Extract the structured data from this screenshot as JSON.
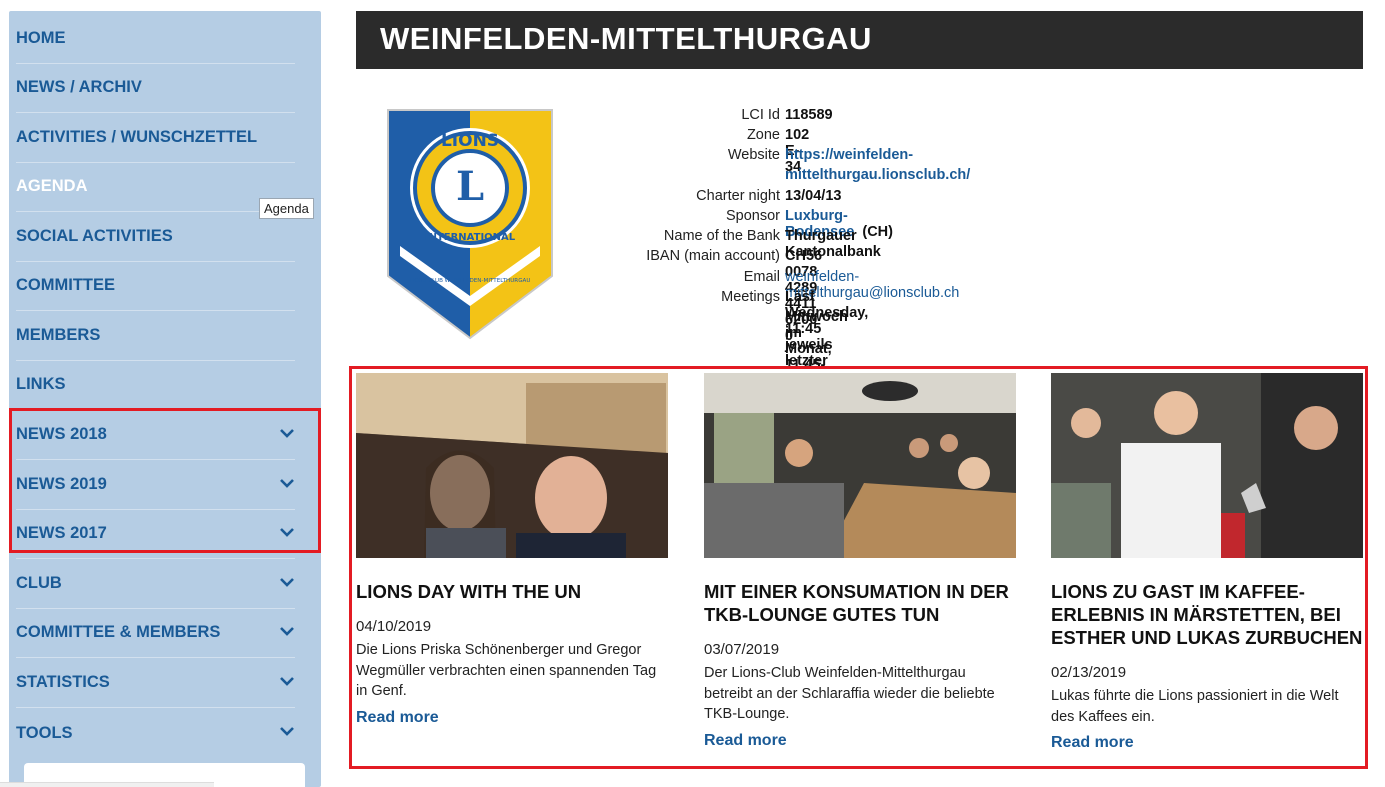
{
  "sidebar": {
    "items": [
      {
        "label": "HOME",
        "has_chevron": false
      },
      {
        "label": "NEWS / ARCHIV",
        "has_chevron": false
      },
      {
        "label": "ACTIVITIES / WUNSCHZETTEL",
        "has_chevron": false
      },
      {
        "label": "AGENDA",
        "has_chevron": false
      },
      {
        "label": "SOCIAL ACTIVITIES",
        "has_chevron": false
      },
      {
        "label": "COMMITTEE",
        "has_chevron": false
      },
      {
        "label": "MEMBERS",
        "has_chevron": false
      },
      {
        "label": "LINKS",
        "has_chevron": false
      },
      {
        "label": "NEWS 2018",
        "has_chevron": true
      },
      {
        "label": "NEWS 2019",
        "has_chevron": true
      },
      {
        "label": "NEWS 2017",
        "has_chevron": true
      },
      {
        "label": "CLUB",
        "has_chevron": true
      },
      {
        "label": "COMMITTEE & MEMBERS",
        "has_chevron": true
      },
      {
        "label": "STATISTICS",
        "has_chevron": true
      },
      {
        "label": "TOOLS",
        "has_chevron": true
      }
    ],
    "tooltip": "Agenda",
    "icons": {
      "chevron": "chevron-down-icon"
    }
  },
  "header": {
    "title": "WEINFELDEN-MITTELTHURGAU"
  },
  "logo": {
    "top_text": "LIONS",
    "letter": "L",
    "ribbon_text": "INTERNATIONAL",
    "bottom_text": "LIONS CLUB WEINFELDEN-MITTELTHURGAU"
  },
  "club_info": {
    "lci_label": "LCI Id",
    "lci_value": "118589",
    "zone_label": "Zone",
    "zone_value": "102 E-34",
    "website_label": "Website",
    "website_line1": "https://weinfelden-",
    "website_line2": "mittelthurgau.lionsclub.ch/",
    "charter_label": "Charter night",
    "charter_value": "13/04/13",
    "sponsor_label": "Sponsor",
    "sponsor_link": "Luxburg-Bodensee",
    "sponsor_suffix": "(CH)",
    "bank_label": "Name of the Bank",
    "bank_value": "Thurgauer Kantonalbank",
    "iban_label": "IBAN (main account)",
    "iban_value": "CH56 0078 4289 4411 6200 0",
    "email_label": "Email",
    "email_value": "weinfelden-mittelthurgau@lionsclub.ch",
    "meetings_label": "Meetings",
    "meetings_line1": "Last Wednesday, 11:45 jeweils letzter",
    "meetings_line2": "Mittwoch im Monat, 11.45-13.30 Uhr"
  },
  "news": [
    {
      "title": "LIONS DAY WITH THE UN",
      "date": "04/10/2019",
      "excerpt": "Die Lions Priska Schönenberger und Gregor Wegmüller verbrachten einen spannenden Tag in Genf.",
      "more": "Read more"
    },
    {
      "title": "MIT EINER KONSUMATION IN DER TKB-LOUNGE GUTES TUN",
      "date": "03/07/2019",
      "excerpt": "Der Lions-Club Weinfelden-Mittelthurgau betreibt an der Schlaraffia wieder die beliebte TKB-Lounge.",
      "more": "Read more"
    },
    {
      "title": "LIONS ZU GAST IM KAFFEE-ERLEBNIS IN MÄRSTETTEN, BEI ESTHER UND LUKAS ZURBUCHEN",
      "date": "02/13/2019",
      "excerpt": "Lukas führte die Lions passioniert in die Welt des Kaffees ein.",
      "more": "Read more"
    }
  ],
  "colors": {
    "sidebar_bg": "#b5cde4",
    "nav_text": "#1a5a96",
    "header_bg": "#2b2b2b",
    "highlight": "#e31b23",
    "link": "#1a5a96"
  }
}
